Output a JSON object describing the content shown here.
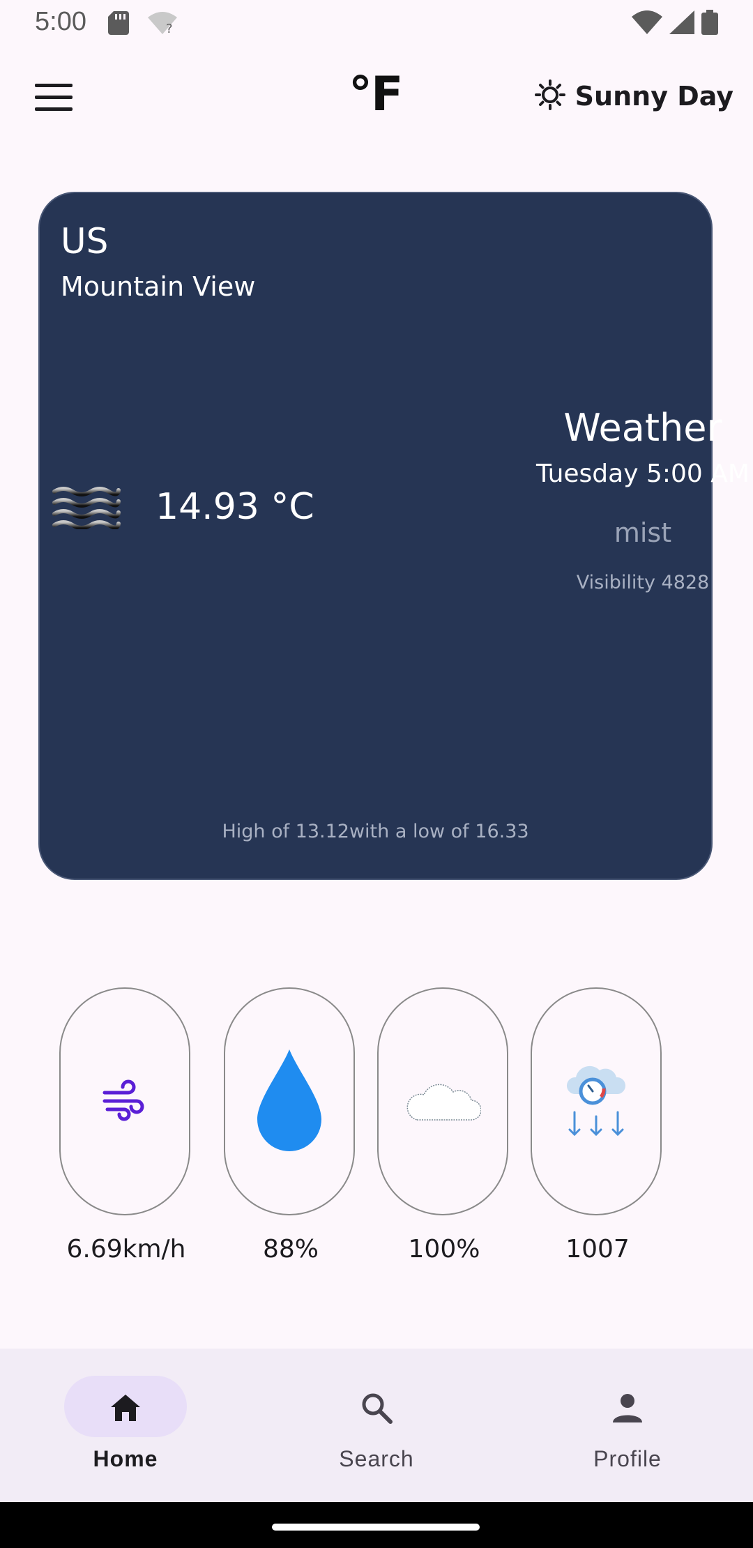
{
  "status_bar": {
    "time": "5:00"
  },
  "app_bar": {
    "unit_toggle": "°F",
    "theme_label": "Sunny Day",
    "theme_icon": "sun-icon",
    "menu_icon": "menu-icon"
  },
  "card": {
    "country": "US",
    "city": "Mountain View",
    "temperature": "14.93 °C",
    "heading": "Weather",
    "datetime": "Tuesday 5:00 AM",
    "description": "mist",
    "visibility_label": "Visibility",
    "visibility_value": "4828",
    "high_low": "High of 13.12with a low of 16.33",
    "condition_icon": "mist-icon",
    "background_color": "#263554"
  },
  "stats": [
    {
      "icon": "wind-icon",
      "value": "6.69km/h"
    },
    {
      "icon": "humidity-drop-icon",
      "value": "88%"
    },
    {
      "icon": "cloud-icon",
      "value": "100%"
    },
    {
      "icon": "pressure-icon",
      "value": "1007"
    }
  ],
  "bottom_nav": {
    "items": [
      {
        "label": "Home",
        "icon": "home-icon",
        "active": true
      },
      {
        "label": "Search",
        "icon": "search-icon",
        "active": false
      },
      {
        "label": "Profile",
        "icon": "profile-icon",
        "active": false
      }
    ],
    "active_indicator_color": "#e8def8",
    "background_color": "#f2ecf6"
  }
}
